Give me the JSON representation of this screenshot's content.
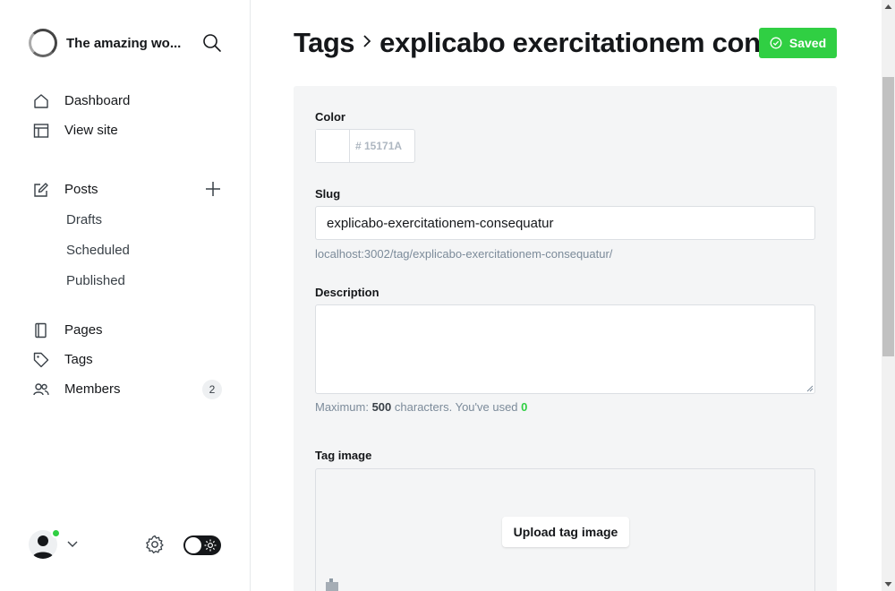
{
  "sidebar": {
    "brand_title": "The amazing wo...",
    "nav_main": [
      {
        "label": "Dashboard",
        "icon": "home-icon"
      },
      {
        "label": "View site",
        "icon": "layout-icon"
      }
    ],
    "posts": {
      "label": "Posts",
      "icon": "edit-icon",
      "sub": [
        "Drafts",
        "Scheduled",
        "Published"
      ]
    },
    "nav_secondary": [
      {
        "label": "Pages",
        "icon": "pages-icon"
      },
      {
        "label": "Tags",
        "icon": "tag-icon"
      },
      {
        "label": "Members",
        "icon": "members-icon",
        "badge": "2"
      }
    ]
  },
  "header": {
    "breadcrumb_root": "Tags",
    "breadcrumb_current": "explicabo exercitationem consequatur",
    "saved_label": "Saved"
  },
  "form": {
    "color_label": "Color",
    "color_value": "# 15171A",
    "slug_label": "Slug",
    "slug_value": "explicabo-exercitationem-consequatur",
    "slug_url": "localhost:3002/tag/explicabo-exercitationem-consequatur/",
    "description_label": "Description",
    "description_hint_prefix": "Maximum:",
    "description_max": "500",
    "description_hint_mid": "characters. You've used",
    "description_used": "0",
    "tag_image_label": "Tag image",
    "upload_label": "Upload tag image"
  },
  "colors": {
    "accent": "#30cf43",
    "text": "#15171a",
    "panel": "#f4f5f6"
  }
}
